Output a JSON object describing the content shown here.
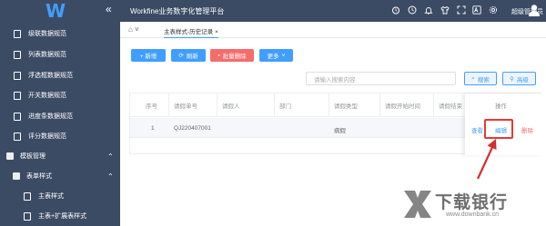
{
  "app_title": "Workfine业务数字化管理平台",
  "user_name": "超级管理员",
  "sidebar": {
    "items": [
      {
        "label": "级联数据规范"
      },
      {
        "label": "列表数据规范"
      },
      {
        "label": "浮选框数据规范"
      },
      {
        "label": "开关数据规范"
      },
      {
        "label": "进度条数据规范"
      },
      {
        "label": "评分数据规范"
      }
    ],
    "section": {
      "label": "模板管理"
    },
    "group": {
      "label": "表单样式"
    },
    "sub_items": [
      {
        "label": "主表样式"
      },
      {
        "label": "主表+扩展表样式"
      }
    ]
  },
  "tabs": [
    {
      "label": "主表样式-历史记录",
      "active": true
    }
  ],
  "toolbar": {
    "add_label": "+ 新增",
    "refresh_label": "刷新",
    "batch_delete_label": "批量删除",
    "more_label": "更多"
  },
  "search": {
    "placeholder": "请输入搜索内容",
    "search_label": "搜索",
    "advanced_label": "高级"
  },
  "table": {
    "columns": [
      "序号",
      "请假单号",
      "请假人",
      "部门",
      "请假类型",
      "请假开始时间",
      "请假结束",
      "操作"
    ],
    "rows": [
      {
        "index": "1",
        "order_no": "QJ220407001",
        "leave_type": "病假",
        "actions": [
          "查看",
          "编辑",
          "删除"
        ]
      }
    ]
  },
  "watermark": {
    "text": "下载银行",
    "url": "www.downbank.cn"
  },
  "colors": {
    "sidebar": "#3c4b64",
    "primary": "#409eff",
    "danger": "#f56c6c",
    "highlight": "#e53935"
  }
}
